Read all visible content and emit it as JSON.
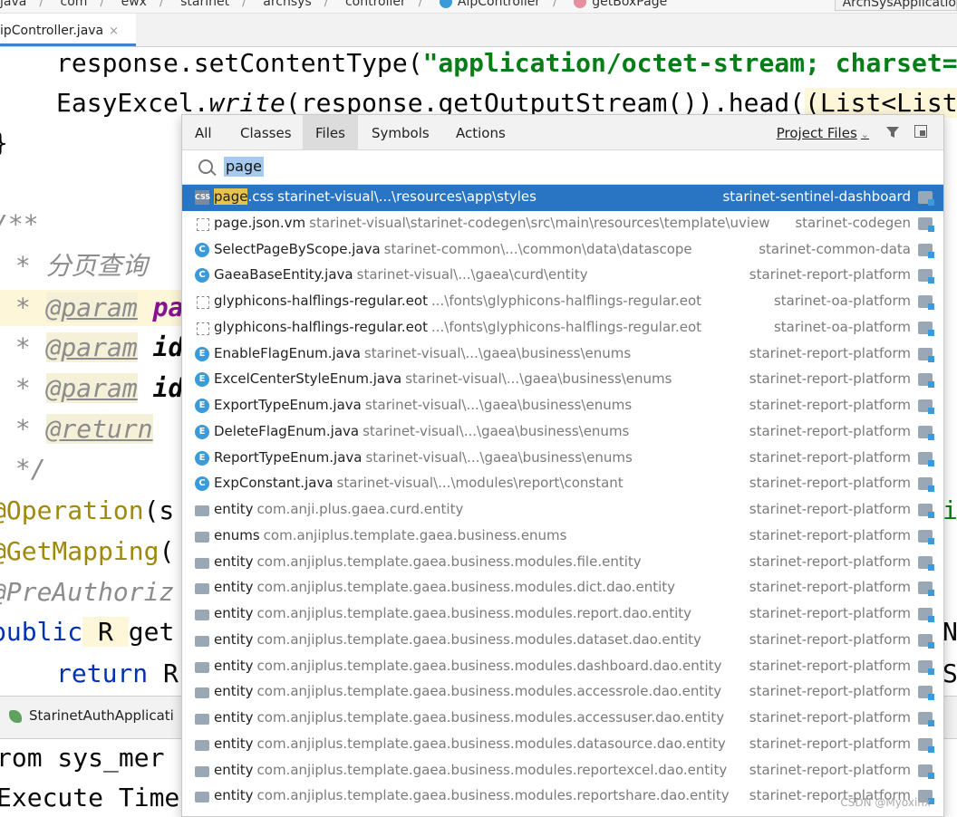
{
  "breadcrumb": {
    "items": [
      "java",
      "com",
      "ewx",
      "starinet",
      "archsys",
      "controller",
      "AlpController",
      "getBoxPage"
    ],
    "run_config": "ArchSysApplicatio"
  },
  "editor_tab": {
    "label": "ipController.java",
    "close": "×"
  },
  "code": {
    "line1": [
      "response.setContentType(",
      "\"application/octet-stream; charset=",
      ""
    ],
    "line2": [
      "EasyExcel.",
      "write",
      "(response.getOutputStream()).head(",
      "(List<List"
    ],
    "line3": "}",
    "line4": "/**",
    "line5": [
      " * ",
      "分页查询"
    ],
    "line6": [
      " * ",
      "@param",
      " ",
      "pa"
    ],
    "line7": [
      " * ",
      "@param",
      " ",
      "id"
    ],
    "line8": [
      " * ",
      "@param",
      " ",
      "id"
    ],
    "line9": [
      " * ",
      "@return"
    ],
    "line10": " */",
    "line11": [
      "@Operation",
      "(s",
      "it"
    ],
    "line12": [
      "@GetMapping",
      "("
    ],
    "line13": "@PreAuthoriz",
    "line14": [
      "public",
      " R ",
      "get",
      "NE"
    ],
    "line15": [
      "return",
      " R",
      "St"
    ]
  },
  "run_tab": {
    "label": "StarinetAuthApplicati"
  },
  "console": {
    "line1": "rom sys_mer",
    "line2": "Execute Time:"
  },
  "popup": {
    "tabs": [
      "All",
      "Classes",
      "Files",
      "Symbols",
      "Actions"
    ],
    "active_tab": "Files",
    "scope": "Project Files",
    "search_query": "page",
    "results": [
      {
        "icon": "css",
        "match": "page",
        "name_rest": ".css",
        "path": "starinet-visual\\...\\resources\\app\\styles",
        "module": "starinet-sentinel-dashboard",
        "selected": true
      },
      {
        "icon": "vm",
        "match": "",
        "name_rest": "page.json.vm",
        "path": "starinet-visual\\starinet-codegen\\src\\main\\resources\\template\\uview",
        "module": "starinet-codegen"
      },
      {
        "icon": "c",
        "match": "",
        "name_rest": "SelectPageByScope.java",
        "path": "starinet-common\\...\\common\\data\\datascope",
        "module": "starinet-common-data"
      },
      {
        "icon": "c",
        "match": "",
        "name_rest": "GaeaBaseEntity.java",
        "path": "starinet-visual\\...\\gaea\\curd\\entity",
        "module": "starinet-report-platform"
      },
      {
        "icon": "eot",
        "match": "",
        "name_rest": "glyphicons-halflings-regular.eot",
        "path": "...\\fonts\\glyphicons-halflings-regular.eot",
        "module": "starinet-oa-platform"
      },
      {
        "icon": "eot",
        "match": "",
        "name_rest": "glyphicons-halflings-regular.eot",
        "path": "...\\fonts\\glyphicons-halflings-regular.eot",
        "module": "starinet-oa-platform"
      },
      {
        "icon": "e",
        "match": "",
        "name_rest": "EnableFlagEnum.java",
        "path": "starinet-visual\\...\\gaea\\business\\enums",
        "module": "starinet-report-platform"
      },
      {
        "icon": "e",
        "match": "",
        "name_rest": "ExcelCenterStyleEnum.java",
        "path": "starinet-visual\\...\\gaea\\business\\enums",
        "module": "starinet-report-platform"
      },
      {
        "icon": "e",
        "match": "",
        "name_rest": "ExportTypeEnum.java",
        "path": "starinet-visual\\...\\gaea\\business\\enums",
        "module": "starinet-report-platform"
      },
      {
        "icon": "e",
        "match": "",
        "name_rest": "DeleteFlagEnum.java",
        "path": "starinet-visual\\...\\gaea\\business\\enums",
        "module": "starinet-report-platform"
      },
      {
        "icon": "e",
        "match": "",
        "name_rest": "ReportTypeEnum.java",
        "path": "starinet-visual\\...\\gaea\\business\\enums",
        "module": "starinet-report-platform"
      },
      {
        "icon": "c",
        "match": "",
        "name_rest": "ExpConstant.java",
        "path": "starinet-visual\\...\\modules\\report\\constant",
        "module": "starinet-report-platform"
      },
      {
        "icon": "folder",
        "match": "",
        "name_rest": "entity",
        "path": "com.anji.plus.gaea.curd.entity",
        "module": "starinet-report-platform"
      },
      {
        "icon": "folder",
        "match": "",
        "name_rest": "enums",
        "path": "com.anjiplus.template.gaea.business.enums",
        "module": "starinet-report-platform"
      },
      {
        "icon": "folder",
        "match": "",
        "name_rest": "entity",
        "path": "com.anjiplus.template.gaea.business.modules.file.entity",
        "module": "starinet-report-platform"
      },
      {
        "icon": "folder",
        "match": "",
        "name_rest": "entity",
        "path": "com.anjiplus.template.gaea.business.modules.dict.dao.entity",
        "module": "starinet-report-platform"
      },
      {
        "icon": "folder",
        "match": "",
        "name_rest": "entity",
        "path": "com.anjiplus.template.gaea.business.modules.report.dao.entity",
        "module": "starinet-report-platform"
      },
      {
        "icon": "folder",
        "match": "",
        "name_rest": "entity",
        "path": "com.anjiplus.template.gaea.business.modules.dataset.dao.entity",
        "module": "starinet-report-platform"
      },
      {
        "icon": "folder",
        "match": "",
        "name_rest": "entity",
        "path": "com.anjiplus.template.gaea.business.modules.dashboard.dao.entity",
        "module": "starinet-report-platform"
      },
      {
        "icon": "folder",
        "match": "",
        "name_rest": "entity",
        "path": "com.anjiplus.template.gaea.business.modules.accessrole.dao.entity",
        "module": "starinet-report-platform"
      },
      {
        "icon": "folder",
        "match": "",
        "name_rest": "entity",
        "path": "com.anjiplus.template.gaea.business.modules.accessuser.dao.entity",
        "module": "starinet-report-platform"
      },
      {
        "icon": "folder",
        "match": "",
        "name_rest": "entity",
        "path": "com.anjiplus.template.gaea.business.modules.datasource.dao.entity",
        "module": "starinet-report-platform"
      },
      {
        "icon": "folder",
        "match": "",
        "name_rest": "entity",
        "path": "com.anjiplus.template.gaea.business.modules.reportexcel.dao.entity",
        "module": "starinet-report-platform"
      },
      {
        "icon": "folder",
        "match": "",
        "name_rest": "entity",
        "path": "com.anjiplus.template.gaea.business.modules.reportshare.dao.entity",
        "module": "starinet-report-platform"
      }
    ],
    "watermark": "CSDN @Myoxinx"
  },
  "colors": {
    "selection": "#2a74c4",
    "accent": "#4083c9",
    "match": "#e6c24f"
  }
}
